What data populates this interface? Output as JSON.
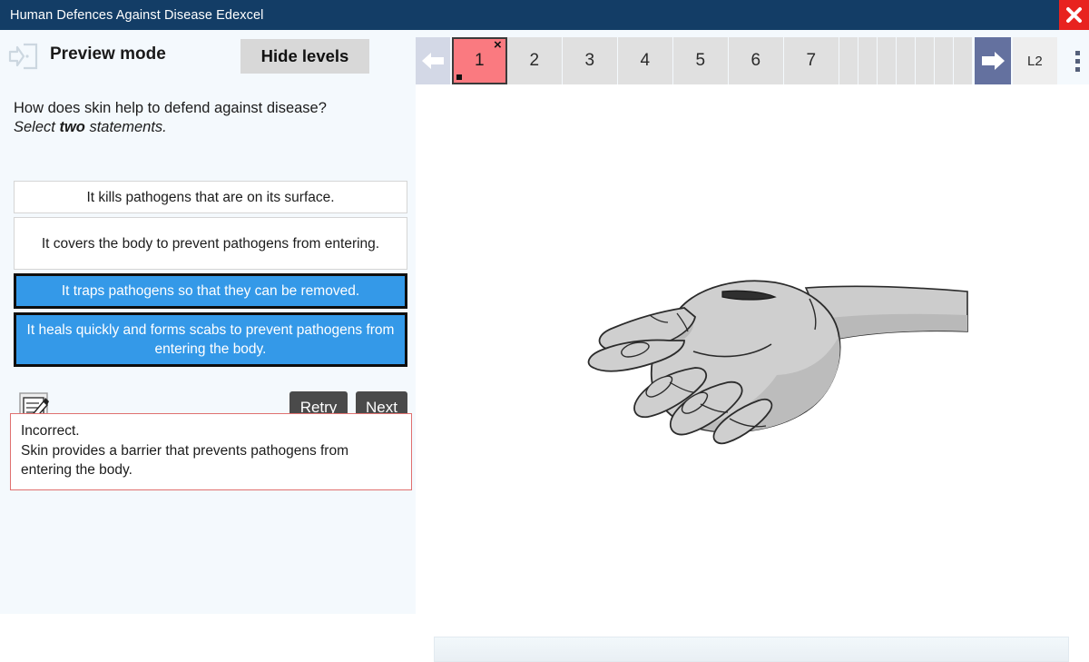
{
  "window": {
    "title": "Human Defences Against Disease Edexcel",
    "close_label": "×",
    "title_bar_color": "#133d66",
    "close_button_color": "#e8231f"
  },
  "sidebar": {
    "exit_icon": "exit-door-icon",
    "preview_mode_label": "Preview mode",
    "hide_levels_label": "Hide levels",
    "question": {
      "prompt": "How does skin help to defend against disease?",
      "instruction_prefix": "Select ",
      "instruction_emphasis": "two",
      "instruction_suffix": " statements."
    },
    "options": [
      {
        "label": "It kills pathogens that are on its surface.",
        "selected": false,
        "lines": 1
      },
      {
        "label": "It covers the body to prevent pathogens from entering.",
        "selected": false,
        "lines": 2
      },
      {
        "label": "It traps pathogens so that they can be removed.",
        "selected": true,
        "lines": 1
      },
      {
        "label": "It heals quickly and forms scabs to prevent pathogens from entering the body.",
        "selected": true,
        "lines": 2
      }
    ],
    "selected_option_color": "#3499e8",
    "annotate_icon": "edit-note-icon",
    "retry_label": "Retry",
    "next_label": "Next",
    "feedback": {
      "status": "Incorrect.",
      "explanation": "Skin provides a barrier that prevents pathogens from entering the body.",
      "border_color": "#e0706f"
    }
  },
  "right_panel": {
    "back_icon": "left-arrow-icon",
    "forward_icon": "right-arrow-icon",
    "pages": [
      "1",
      "2",
      "3",
      "4",
      "5",
      "6",
      "7"
    ],
    "active_page": "1",
    "active_page_marker": "×",
    "blank_page_count": 7,
    "level_label": "L2",
    "menu_icon": "kebab-menu-icon",
    "active_tab_color": "#fa7a80",
    "forward_button_color": "#64719f",
    "stage_image": "hand-with-cut-illustration"
  }
}
